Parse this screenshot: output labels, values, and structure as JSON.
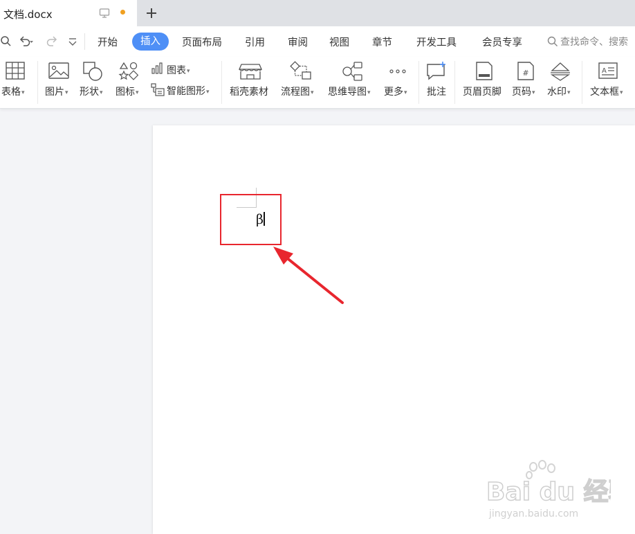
{
  "tab": {
    "title": "文档.docx"
  },
  "menu": {
    "items": [
      "开始",
      "插入",
      "页面布局",
      "引用",
      "审阅",
      "视图",
      "章节",
      "开发工具",
      "会员专享"
    ],
    "active": "插入",
    "search_placeholder": "查找命令、搜索"
  },
  "ribbon": {
    "table": "表格",
    "picture": "图片",
    "shape": "形状",
    "icon": "图标",
    "chart": "图表",
    "smart_art": "智能图形",
    "docer": "稻壳素材",
    "flowchart": "流程图",
    "mindmap": "思维导图",
    "more": "更多",
    "comment": "批注",
    "header_footer": "页眉页脚",
    "page_number": "页码",
    "watermark": "水印",
    "textbox": "文本框"
  },
  "document": {
    "typed_text": "β"
  },
  "watermark": {
    "brand": "Bai du 经验",
    "url": "jingyan.baidu.com"
  },
  "colors": {
    "accent": "#4e8ff6",
    "highlight": "#e8262e",
    "tab_dot": "#f0a020"
  }
}
